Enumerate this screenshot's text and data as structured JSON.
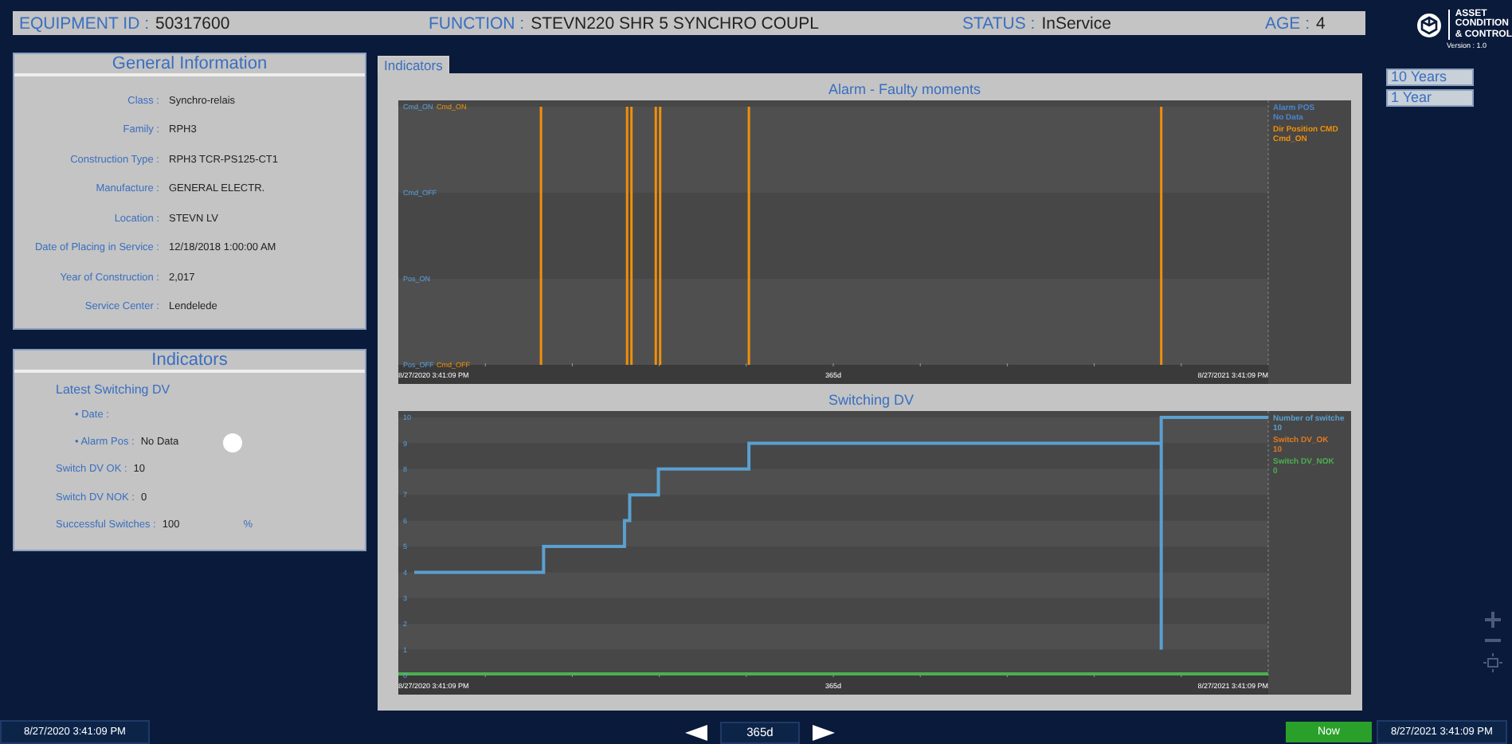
{
  "header": [
    {
      "label": "EQUIPMENT ID :",
      "value": "50317600"
    },
    {
      "label": "FUNCTION :",
      "value": "STEVN220 SHR 5 SYNCHRO COUPL"
    },
    {
      "label": "STATUS :",
      "value": "InService"
    },
    {
      "label": "AGE :",
      "value": "4"
    }
  ],
  "logo": {
    "lines": [
      "ASSET",
      "CONDITION",
      "& CONTROL"
    ],
    "version": "Version : 1.0"
  },
  "general_information": {
    "title": "General Information",
    "fields": [
      {
        "label": "Class :",
        "value": "Synchro-relais"
      },
      {
        "label": "Family :",
        "value": "RPH3"
      },
      {
        "label": "Construction Type :",
        "value": "RPH3 TCR-PS125-CT1"
      },
      {
        "label": "Manufacture :",
        "value": "GENERAL ELECTR."
      },
      {
        "label": "Location :",
        "value": "STEVN LV"
      },
      {
        "label": "Date of Placing in Service :",
        "value": "12/18/2018 1:00:00 AM"
      },
      {
        "label": "Year of Construction :",
        "value": "2,017"
      },
      {
        "label": "Service Center :",
        "value": "Lendelede"
      }
    ]
  },
  "indicators": {
    "title": "Indicators",
    "items": [
      {
        "kind": "heading",
        "label": "Latest Switching DV"
      },
      {
        "kind": "sub",
        "label": "• Date :"
      },
      {
        "kind": "lamp",
        "label": "• Alarm Pos :",
        "value": "No Data",
        "color": "#ffffff"
      },
      {
        "kind": "stat",
        "label": "Switch DV OK :",
        "value": "10"
      },
      {
        "kind": "stat",
        "label": "Switch DV NOK :",
        "value": "0"
      },
      {
        "kind": "stat",
        "label": "Successful Switches :",
        "value": "100",
        "unit": "%"
      }
    ]
  },
  "tabs": [
    {
      "label": "Indicators",
      "selected": true
    }
  ],
  "alarm_chart": {
    "title": "Alarm - Faulty moments",
    "y_labels": [
      "Cmd_ON",
      "Cmd_OFF",
      "Pos_ON",
      "Pos_OFF"
    ],
    "y_labels_second": [
      "Cmd_ON",
      "Cmd_OFF"
    ],
    "legend": [
      {
        "name": "Alarm POS",
        "reading": "No Data",
        "color": "#4a86d0"
      },
      {
        "name": "Dir Position CMD",
        "reading": "Cmd_ON",
        "color": "#f0900a"
      }
    ],
    "axis_labels": [
      "8/27/2020 3:41:09 PM",
      "365d",
      "8/27/2021 3:41:09 PM"
    ]
  },
  "switching_chart": {
    "title": "Switching DV",
    "y_labels": [
      "10",
      "9",
      "8",
      "7",
      "6",
      "5",
      "4",
      "3",
      "2",
      "1",
      "0"
    ],
    "legend": [
      {
        "name": "Number of switche",
        "reading": "10",
        "color": "#5aa0d0"
      },
      {
        "name": "Switch DV_OK",
        "reading": "10",
        "color": "#e07b20"
      },
      {
        "name": "Switch DV_NOK",
        "reading": "0",
        "color": "#4caf50"
      }
    ],
    "axis_labels": [
      "8/27/2020 3:41:09 PM",
      "365d",
      "8/27/2021 3:41:09 PM"
    ]
  },
  "range_buttons": [
    {
      "label": "10 Years"
    },
    {
      "label": "1 Year"
    }
  ],
  "footer": {
    "start": "8/27/2020 3:41:09 PM",
    "period": "365d",
    "now": "Now",
    "end": "8/27/2021 3:41:09 PM"
  }
}
